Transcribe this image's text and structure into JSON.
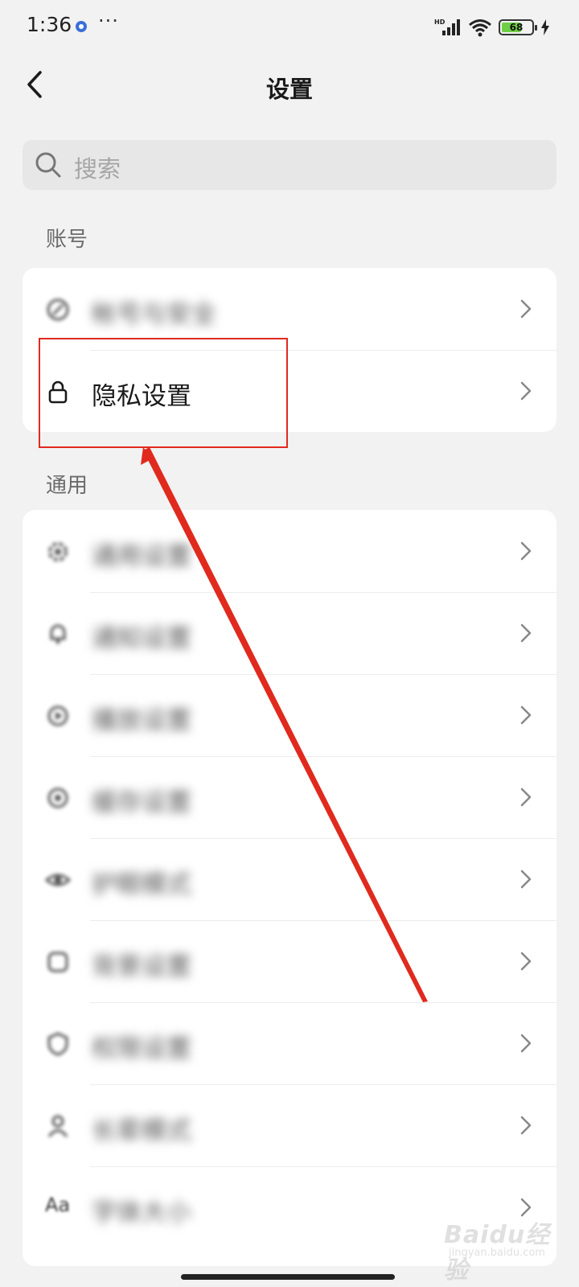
{
  "status_bar": {
    "time": "1:36",
    "more": "···",
    "network": "HD",
    "battery_level": "68",
    "battery_fraction": 0.68
  },
  "header": {
    "title": "设置",
    "back_icon": "chevron-left-icon"
  },
  "search": {
    "placeholder": "搜索",
    "icon": "search-icon"
  },
  "sections": {
    "account": {
      "label": "账号",
      "items": [
        {
          "label": "帐号与安全",
          "icon": "account-icon",
          "obscured": true
        },
        {
          "label": "隐私设置",
          "icon": "lock-icon",
          "obscured": false
        }
      ]
    },
    "general": {
      "label": "通用",
      "items": [
        {
          "label": "通用设置",
          "icon": "gear-icon",
          "obscured": true
        },
        {
          "label": "通知设置",
          "icon": "bell-icon",
          "obscured": true
        },
        {
          "label": "播放设置",
          "icon": "play-icon",
          "obscured": true
        },
        {
          "label": "缓存设置",
          "icon": "storage-icon",
          "obscured": true
        },
        {
          "label": "护眼模式",
          "icon": "eye-icon",
          "obscured": true
        },
        {
          "label": "背景设置",
          "icon": "background-icon",
          "obscured": true
        },
        {
          "label": "权限设置",
          "icon": "shield-icon",
          "obscured": true
        },
        {
          "label": "长辈模式",
          "icon": "person-icon",
          "obscured": true
        },
        {
          "label": "字体大小",
          "icon": "font-size-icon",
          "obscured": true
        }
      ]
    }
  },
  "font_size_glyph": "Aa",
  "watermark": {
    "logo": "Baidu经验",
    "sub": "jingyan.baidu.com"
  },
  "colors": {
    "background": "#f2f2f2",
    "card": "#ffffff",
    "annotation": "#e02a1e",
    "battery": "#6fcf44"
  }
}
